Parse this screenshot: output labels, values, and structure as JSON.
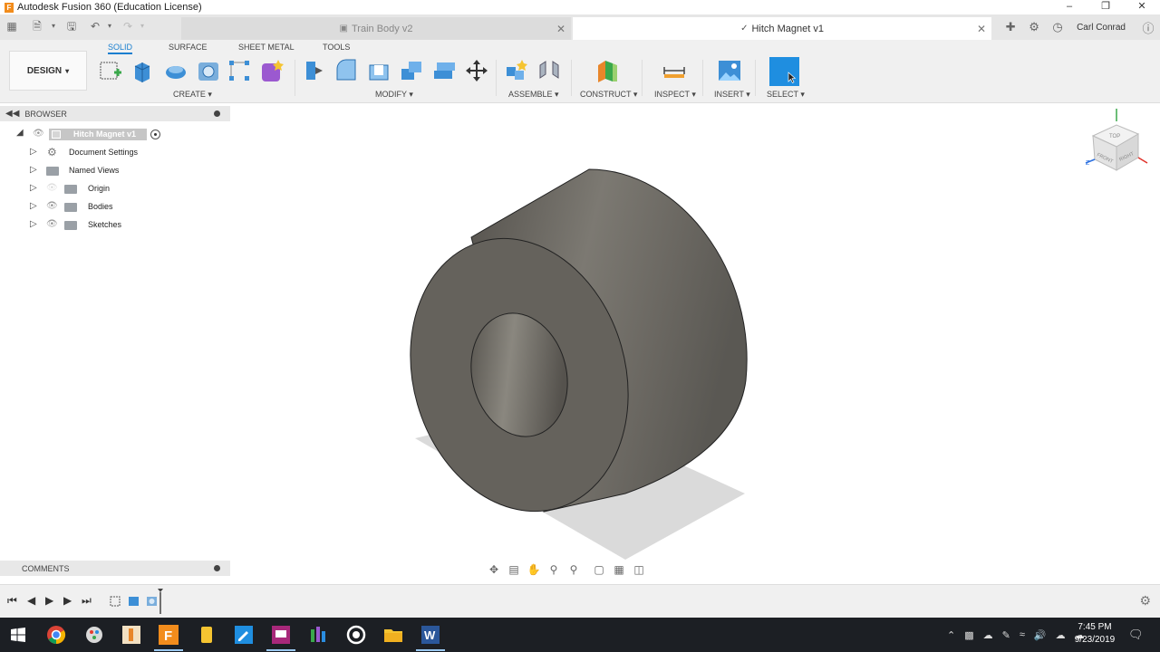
{
  "window": {
    "title": "Autodesk Fusion 360 (Education License)",
    "logo_letter": "F",
    "min_icon": "minimize-icon",
    "max_icon": "restore-icon",
    "close_icon": "close-icon"
  },
  "tabs": [
    {
      "label": "Train Body v2",
      "active": false
    },
    {
      "label": "Hitch Magnet v1",
      "active": true
    }
  ],
  "user": {
    "name": "Carl Conrad"
  },
  "workspace": {
    "design_label": "DESIGN",
    "tabs": [
      "SOLID",
      "SURFACE",
      "SHEET METAL",
      "TOOLS"
    ],
    "active_tab": "SOLID"
  },
  "toolbar_groups": [
    "CREATE",
    "MODIFY",
    "ASSEMBLE",
    "CONSTRUCT",
    "INSPECT",
    "INSERT",
    "SELECT"
  ],
  "browser": {
    "title": "BROWSER",
    "root": "Hitch Magnet v1",
    "items": [
      "Document Settings",
      "Named Views",
      "Origin",
      "Bodies",
      "Sketches"
    ]
  },
  "comments": {
    "title": "COMMENTS"
  },
  "viewcube": {
    "top": "TOP",
    "front": "FRONT",
    "right": "RIGHT"
  },
  "taskbar": {
    "time": "7:45 PM",
    "date": "9/23/2019"
  },
  "colors": {
    "accent": "#1f8ee0",
    "toolbar_bg": "#f0f0f0",
    "model": "#6f6c66",
    "taskbar": "#1c1f24"
  }
}
